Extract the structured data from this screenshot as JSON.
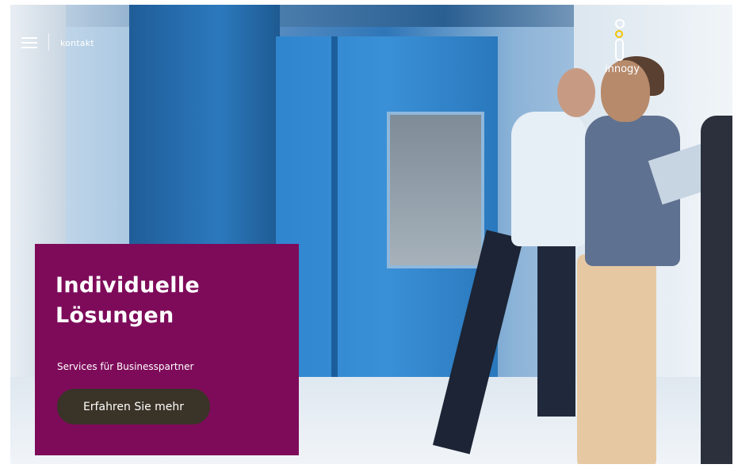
{
  "header": {
    "nav_text": "kontakt",
    "brand": "innogy"
  },
  "hero": {
    "title": "Individuelle Lösungen",
    "subtitle": "Services für Businesspartner",
    "cta_label": "Erfahren Sie mehr"
  },
  "colors": {
    "teaser_bg": "#7e0b5a",
    "cta_bg": "#3a3327"
  }
}
